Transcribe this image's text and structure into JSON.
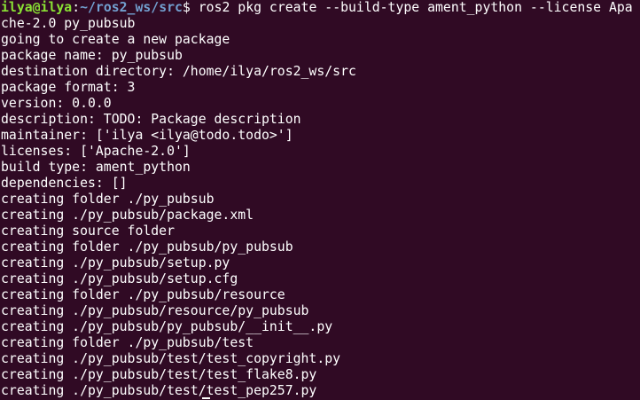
{
  "prompt": {
    "user_host": "ilya@ilya",
    "sep": ":",
    "path": "~/ros2_ws/src",
    "symbol": "$ ",
    "command_line1": "ros2 pkg create --build-type ament_python --license Apa",
    "command_line2": "che-2.0 py_pubsub"
  },
  "output": [
    "going to create a new package",
    "package name: py_pubsub",
    "destination directory: /home/ilya/ros2_ws/src",
    "package format: 3",
    "version: 0.0.0",
    "description: TODO: Package description",
    "maintainer: ['ilya <ilya@todo.todo>']",
    "licenses: ['Apache-2.0']",
    "build type: ament_python",
    "dependencies: []",
    "creating folder ./py_pubsub",
    "creating ./py_pubsub/package.xml",
    "creating source folder",
    "creating folder ./py_pubsub/py_pubsub",
    "creating ./py_pubsub/setup.py",
    "creating ./py_pubsub/setup.cfg",
    "creating folder ./py_pubsub/resource",
    "creating ./py_pubsub/resource/py_pubsub",
    "creating ./py_pubsub/py_pubsub/__init__.py",
    "creating folder ./py_pubsub/test",
    "creating ./py_pubsub/test/test_copyright.py",
    "creating ./py_pubsub/test/test_flake8.py",
    "creating ./py_pubsub/test/test_pep257.py"
  ],
  "colors": {
    "background": "#300a24",
    "text": "#ffffff",
    "user": "#8ae234",
    "path": "#729fcf"
  }
}
